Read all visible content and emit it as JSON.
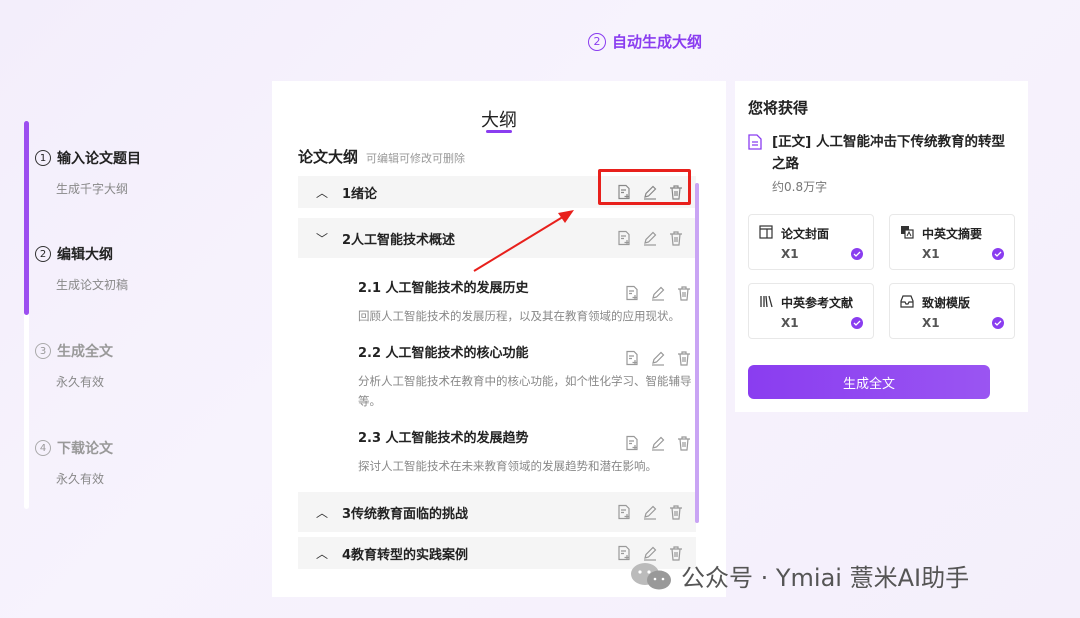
{
  "header": {
    "step_number": "2",
    "step_label": "自动生成大纲"
  },
  "steps": [
    {
      "num": "1",
      "title": "输入论文题目",
      "sub": "生成千字大纲"
    },
    {
      "num": "2",
      "title": "编辑大纲",
      "sub": "生成论文初稿"
    },
    {
      "num": "3",
      "title": "生成全文",
      "sub": "永久有效"
    },
    {
      "num": "4",
      "title": "下载论文",
      "sub": "永久有效"
    }
  ],
  "outline": {
    "panel_title": "大纲",
    "heading": "论文大纲",
    "hint": "可编辑可修改可删除",
    "chapters": [
      {
        "chevron": "up",
        "label": "1绪论"
      },
      {
        "chevron": "down",
        "label": "2人工智能技术概述"
      },
      {
        "chevron": "up",
        "label": "3传统教育面临的挑战"
      },
      {
        "chevron": "up",
        "label": "4教育转型的实践案例"
      }
    ],
    "sections": [
      {
        "title": "2.1 人工智能技术的发展历史",
        "desc": "回顾人工智能技术的发展历程，以及其在教育领域的应用现状。"
      },
      {
        "title": "2.2 人工智能技术的核心功能",
        "desc": "分析人工智能技术在教育中的核心功能，如个性化学习、智能辅导等。"
      },
      {
        "title": "2.3 人工智能技术的发展趋势",
        "desc": "探讨人工智能技术在未来教育领域的发展趋势和潜在影响。"
      }
    ]
  },
  "result": {
    "title": "您将获得",
    "doc_title": "[正文] 人工智能冲击下传统教育的转型之路",
    "doc_words": "约0.8万字",
    "items": [
      {
        "name": "论文封面",
        "qty": "X1",
        "icon": "cover-icon"
      },
      {
        "name": "中英文摘要",
        "qty": "X1",
        "icon": "translate-icon"
      },
      {
        "name": "中英参考文献",
        "qty": "X1",
        "icon": "books-icon"
      },
      {
        "name": "致谢模版",
        "qty": "X1",
        "icon": "inbox-icon"
      }
    ],
    "generate_label": "生成全文"
  },
  "colors": {
    "accent": "#8a3df0",
    "highlight_box": "#e8201c"
  },
  "watermark": "公众号 · Ymiai 薏米AI助手"
}
